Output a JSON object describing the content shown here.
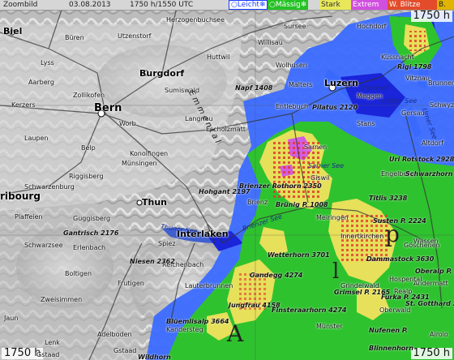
{
  "header": {
    "zoom_label": "Zoombild",
    "date": "03.08.2013",
    "time": "1750 h/1550 UTC"
  },
  "legend": [
    {
      "label": "Leicht",
      "bg": "#ffffff",
      "fg": "#1a3cff",
      "prefix": "○"
    },
    {
      "label": "Mässig",
      "bg": "#24c224",
      "fg": "#ffffff",
      "prefix": "○"
    },
    {
      "label": "Stark",
      "bg": "#e8e85a",
      "fg": "#333333"
    },
    {
      "label": "Extrem",
      "bg": "#d14fe0",
      "fg": "#ffffff"
    },
    {
      "label": "W. Blitze",
      "bg": "#e34b2a",
      "fg": "#ffffff"
    },
    {
      "label": "B.",
      "bg": "#e0b400",
      "fg": "#222222"
    }
  ],
  "corners": {
    "top_right": "1750 h",
    "bottom_left": "1750 h",
    "bottom_right": "1750 h"
  },
  "cities": [
    {
      "name": "Bern"
    },
    {
      "name": "Burgdorf"
    },
    {
      "name": "Thun"
    },
    {
      "name": "Interlaken"
    },
    {
      "name": "Luzern"
    },
    {
      "name": "Biel"
    }
  ],
  "places": [
    "Büren",
    "Utzenstorf",
    "Herzogenbuchsee",
    "Sursee",
    "Hochdorf",
    "Willisau",
    "Huttwil",
    "Lyss",
    "Aarberg",
    "Zollikofen",
    "Kerzers",
    "Worb",
    "Langnau",
    "Escholzmatt",
    "Entlebuch",
    "Wolhusen",
    "Malters",
    "Sumiswald",
    "Laupen",
    "Belp",
    "Konolfingen",
    "Münsingen",
    "Riggisberg",
    "Schwarzenburg",
    "Plaffeien",
    "Guggisberg",
    "Schwarzsee",
    "Erlenbach",
    "Spiez",
    "Brienz",
    "Meiringen",
    "Innertkirchen",
    "Wassen",
    "Göschenen",
    "Andermatt",
    "Engelberg",
    "Altdorf",
    "Stans",
    "Sarnen",
    "Giswil",
    "Küssnacht",
    "Vitznau",
    "Brunnen",
    "Reichenbach",
    "Frutigen",
    "Adelboden",
    "Lenk",
    "Zweisimmen",
    "Boltigen",
    "Lauterbrunnen",
    "Grindelwald",
    "Kandersteg",
    "Gstaad",
    "Jaun",
    "Oberwald",
    "Münster",
    "Realp",
    "Airolo",
    "Hospental",
    "Meggen",
    "Schwyz",
    "Gersau"
  ],
  "peaks": [
    {
      "name": "Napf",
      "elev": "1408"
    },
    {
      "name": "Pilatus",
      "elev": "2120"
    },
    {
      "name": "Hohgant",
      "elev": "2197"
    },
    {
      "name": "Brienzer Rothorn",
      "elev": "2350"
    },
    {
      "name": "Brünig P.",
      "elev": "1008"
    },
    {
      "name": "Titlis",
      "elev": "3238"
    },
    {
      "name": "Uri Rotstock",
      "elev": "2928"
    },
    {
      "name": "Wetterhorn",
      "elev": "3701"
    },
    {
      "name": "Gandegg",
      "elev": "4274"
    },
    {
      "name": "Jungfrau",
      "elev": "4158"
    },
    {
      "name": "Finsteraarhorn",
      "elev": "4274"
    },
    {
      "name": "Dammastock",
      "elev": "3630"
    },
    {
      "name": "Blüemlisalp",
      "elev": "3664"
    },
    {
      "name": "Niesen",
      "elev": "2362"
    },
    {
      "name": "Rigi",
      "elev": "1798"
    },
    {
      "name": "Schwarzhorn",
      "elev": "2928"
    },
    {
      "name": "Susten P.",
      "elev": "2224"
    },
    {
      "name": "Furka P.",
      "elev": "2431"
    },
    {
      "name": "Grimsel P.",
      "elev": "2165"
    },
    {
      "name": "St. Gotthard",
      "elev": "2108"
    },
    {
      "name": "Oberalp P.",
      "elev": "2044"
    },
    {
      "name": "Gantrisch",
      "elev": "2176"
    }
  ],
  "lakes": [
    "Brienzer See",
    "Thuner See",
    "Vierwald",
    "stätter See",
    "Urner See",
    "Sarner See"
  ],
  "regions": [
    {
      "text": "A"
    },
    {
      "text": "l"
    },
    {
      "text": "p"
    },
    {
      "text": "Emmental"
    },
    {
      "text": "ribourg"
    }
  ],
  "misc_labels": [
    "Gstaad",
    "Blinnenhorn",
    "Nufenen P.",
    "Wildhorn"
  ],
  "intensity_colors": {
    "light": "#3b6cff",
    "light_dark": "#1a24d8",
    "moderate": "#2ec22e",
    "strong": "#e6e05a",
    "extreme": "#d35ce3",
    "lightning": "#e03a2a"
  }
}
